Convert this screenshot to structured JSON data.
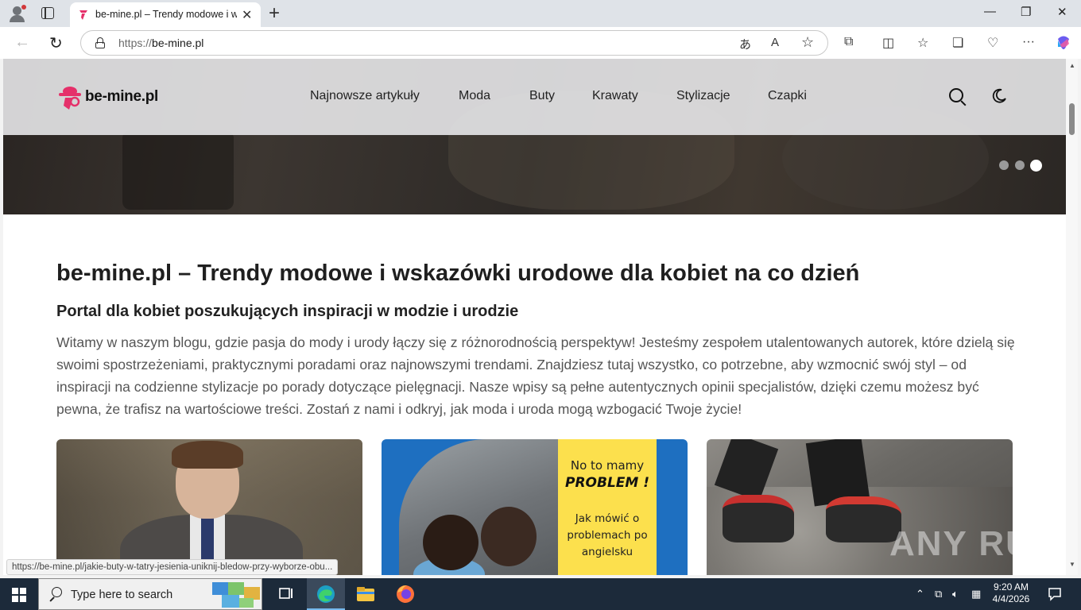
{
  "browser": {
    "tab_title": "be-mine.pl – Trendy modowe i wskazówki urodowe dla kobiet na co dzień",
    "url_protocol": "https://",
    "url_host": "be-mine.pl",
    "status_url": "https://be-mine.pl/jakie-buty-w-tatry-jesienia-uniknij-bledow-przy-wyborze-obu..."
  },
  "site": {
    "logo_text": "be-mine.pl",
    "brand_color": "#e5306a",
    "menu": [
      "Najnowsze artykuły",
      "Moda",
      "Buty",
      "Krawaty",
      "Stylizacje",
      "Czapki"
    ],
    "slider_active_index": 2
  },
  "content": {
    "title": "be-mine.pl – Trendy modowe i wskazówki urodowe dla kobiet na co dzień",
    "subtitle": "Portal dla kobiet poszukujących inspiracji w modzie i urodzie",
    "intro": "Witamy w naszym blogu, gdzie pasja do mody i urody łączy się z różnorodnością perspektyw! Jesteśmy zespołem utalentowanych autorek, które dzielą się swoimi spostrzeżeniami, praktycznymi poradami oraz najnowszymi trendami. Znajdziesz tutaj wszystko, co potrzebne, aby wzmocnić swój styl – od inspiracji na codzienne stylizacje po porady dotyczące pielęgnacji. Nasze wpisy są pełne autentycznych opinii specjalistów, dzięki czemu możesz być pewna, że trafisz na wartościowe treści. Zostań z nami i odkryj, jak moda i uroda mogą wzbogacić Twoje życie!",
    "card2_line1": "No to mamy",
    "card2_line2": "PROBLEM !",
    "card2_line3": "Jak mówić o problemach po angielsku"
  },
  "watermark": "ANY RUN",
  "taskbar": {
    "search_placeholder": "Type here to search",
    "time": "9:20 AM",
    "date": "4/4/2026"
  }
}
